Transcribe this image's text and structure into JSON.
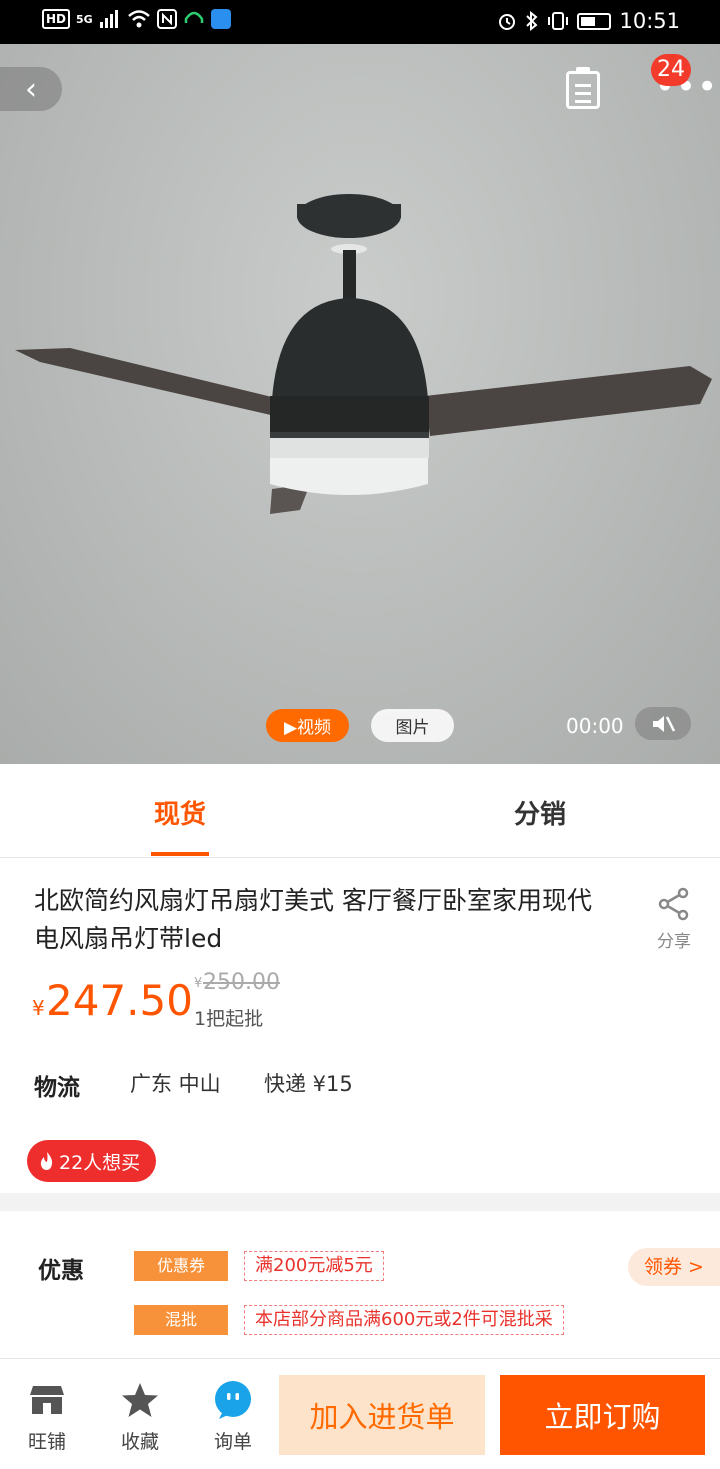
{
  "status_bar": {
    "network_badge": "HD",
    "network_type": "5G",
    "time": "10:51"
  },
  "hero": {
    "cart_badge_count": "24",
    "video_button": "▶视频",
    "photo_button": "图片",
    "video_time": "00:00"
  },
  "tabs": [
    {
      "label": "现货",
      "active": true
    },
    {
      "label": "分销",
      "active": false
    }
  ],
  "product": {
    "title": "北欧简约风扇灯吊扇灯美式 客厅餐厅卧室家用现代电风扇吊灯带led",
    "share_label": "分享",
    "currency": "¥",
    "price": "247.50",
    "original_price": "250.00",
    "min_order": "1把起批",
    "shipping_label": "物流",
    "shipping_origin": "广东 中山",
    "shipping_fee": "快递 ¥15",
    "want_count_text": "22人想买"
  },
  "promotions": {
    "label": "优惠",
    "items": [
      {
        "tag": "优惠券",
        "desc": "满200元减5元"
      },
      {
        "tag": "混批",
        "desc": "本店部分商品满600元或2件可混批采"
      }
    ],
    "coupon_button": "领券 >"
  },
  "bottom_bar": {
    "shop_label": "旺铺",
    "favorite_label": "收藏",
    "inquiry_label": "询单",
    "add_to_list_button": "加入进货单",
    "order_button": "立即订购"
  },
  "colors": {
    "accent": "#ff5500",
    "badge_red": "#ee2d2d",
    "tag_orange": "#f8923a"
  }
}
